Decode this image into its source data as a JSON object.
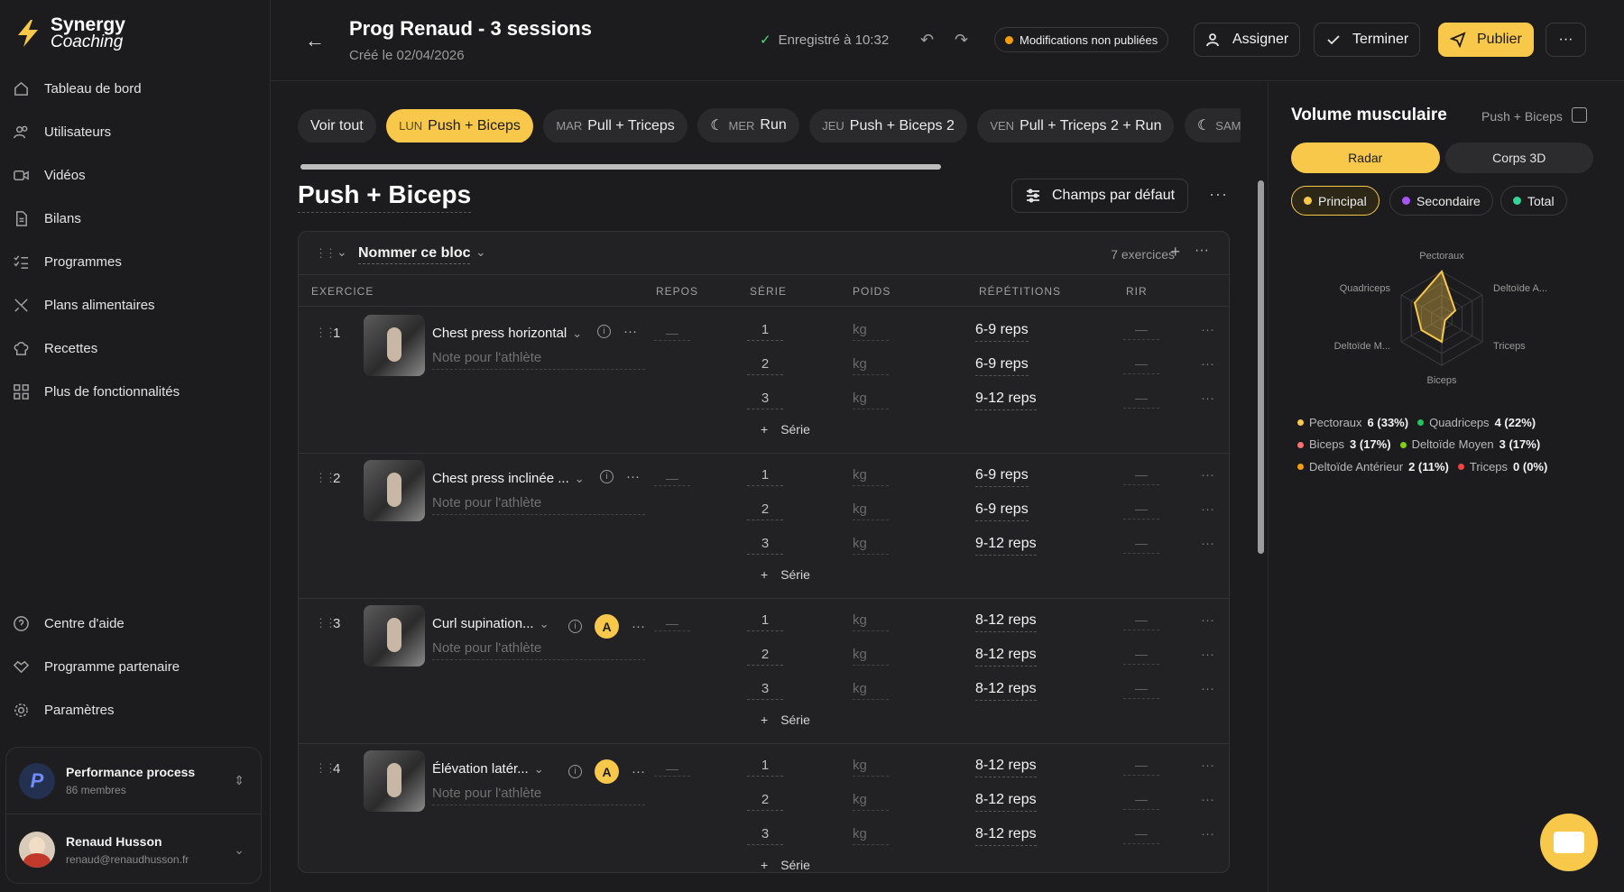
{
  "app": {
    "brand_line1": "Synergy",
    "brand_line2": "Coaching"
  },
  "sidebar": {
    "items": [
      {
        "label": "Tableau de bord",
        "icon": "home-icon"
      },
      {
        "label": "Utilisateurs",
        "icon": "users-icon"
      },
      {
        "label": "Vidéos",
        "icon": "video-icon"
      },
      {
        "label": "Bilans",
        "icon": "document-icon"
      },
      {
        "label": "Programmes",
        "icon": "list-check-icon"
      },
      {
        "label": "Plans alimentaires",
        "icon": "utensils-icon"
      },
      {
        "label": "Recettes",
        "icon": "chef-hat-icon"
      },
      {
        "label": "Plus de fonctionnalités",
        "icon": "grid-icon"
      }
    ],
    "bottom_items": [
      {
        "label": "Centre d'aide",
        "icon": "help-icon"
      },
      {
        "label": "Programme partenaire",
        "icon": "handshake-icon"
      },
      {
        "label": "Paramètres",
        "icon": "gear-icon"
      }
    ],
    "workspace": {
      "name": "Performance process",
      "members": "86 membres"
    },
    "user": {
      "name": "Renaud Husson",
      "email": "renaud@renaudhusson.fr"
    }
  },
  "header": {
    "title": "Prog Renaud - 3 sessions",
    "created": "Créé le 02/04/2026",
    "saved": "Enregistré à 10:32",
    "unpublished": "Modifications non publiées",
    "assign": "Assigner",
    "finish": "Terminer",
    "publish": "Publier"
  },
  "tabs": [
    {
      "day": "",
      "label": "Voir tout"
    },
    {
      "day": "LUN",
      "label": "Push + Biceps",
      "active": true
    },
    {
      "day": "MAR",
      "label": "Pull + Triceps"
    },
    {
      "day": "MER",
      "label": "Run",
      "icon": "moon-icon"
    },
    {
      "day": "JEU",
      "label": "Push + Biceps 2"
    },
    {
      "day": "VEN",
      "label": "Pull + Triceps 2 + Run"
    },
    {
      "day": "SAM",
      "label": "",
      "icon": "moon-icon"
    }
  ],
  "session": {
    "title": "Push + Biceps",
    "defaults_button": "Champs par défaut"
  },
  "block": {
    "name": "Nommer ce bloc",
    "count": "7 exercices",
    "columns": [
      "EXERCICE",
      "REPOS",
      "SÉRIE",
      "POIDS",
      "RÉPÉTITIONS",
      "RIR"
    ],
    "note_placeholder": "Note pour l'athlète",
    "add_set": "Série",
    "weight_unit": "kg",
    "empty": "—",
    "exercises": [
      {
        "num": "1",
        "name": "Chest press horizontal",
        "badge": "",
        "sets": [
          "1",
          "2",
          "3"
        ],
        "reps": [
          "6-9 reps",
          "6-9 reps",
          "9-12 reps"
        ]
      },
      {
        "num": "2",
        "name": "Chest press inclinée ...",
        "badge": "",
        "sets": [
          "1",
          "2",
          "3"
        ],
        "reps": [
          "6-9 reps",
          "6-9 reps",
          "9-12 reps"
        ]
      },
      {
        "num": "3",
        "name": "Curl supination...",
        "badge": "A",
        "sets": [
          "1",
          "2",
          "3"
        ],
        "reps": [
          "8-12 reps",
          "8-12 reps",
          "8-12 reps"
        ]
      },
      {
        "num": "4",
        "name": "Élévation latér...",
        "badge": "A",
        "sets": [
          "1",
          "2",
          "3"
        ],
        "reps": [
          "8-12 reps",
          "8-12 reps",
          "8-12 reps"
        ]
      }
    ]
  },
  "panel": {
    "title": "Volume musculaire",
    "session": "Push + Biceps",
    "views": [
      "Radar",
      "Corps 3D"
    ],
    "filters": [
      {
        "label": "Principal",
        "color": "#f8c84a"
      },
      {
        "label": "Secondaire",
        "color": "#a855f7"
      },
      {
        "label": "Total",
        "color": "#34d399"
      }
    ],
    "radar_labels": [
      "Pectoraux",
      "Deltoïde A...",
      "Triceps",
      "Biceps",
      "Deltoïde M...",
      "Quadriceps"
    ],
    "legend": [
      {
        "name": "Pectoraux",
        "value": "6 (33%)",
        "color": "#f8c84a"
      },
      {
        "name": "Quadriceps",
        "value": "4 (22%)",
        "color": "#22c55e"
      },
      {
        "name": "Biceps",
        "value": "3 (17%)",
        "color": "#f87171"
      },
      {
        "name": "Deltoïde Moyen",
        "value": "3 (17%)",
        "color": "#84cc16"
      },
      {
        "name": "Deltoïde Antérieur",
        "value": "2 (11%)",
        "color": "#f59e0b"
      },
      {
        "name": "Triceps",
        "value": "0 (0%)",
        "color": "#ef4444"
      }
    ],
    "radar_values": [
      6,
      2,
      0,
      3,
      3,
      4
    ]
  }
}
